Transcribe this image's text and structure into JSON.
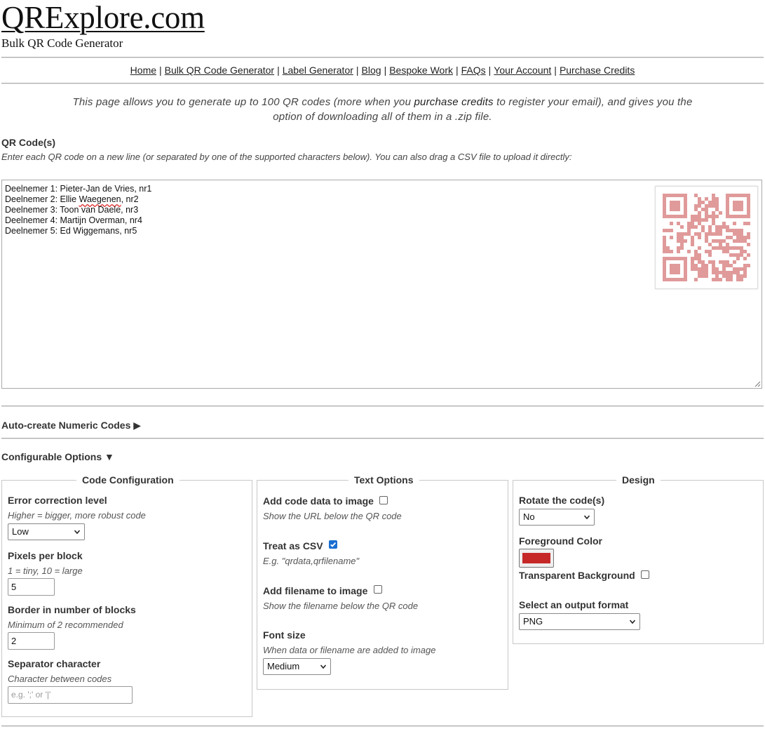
{
  "site": {
    "logo": "QRExplore.com",
    "tagline": "Bulk QR Code Generator"
  },
  "nav": [
    {
      "label": "Home"
    },
    {
      "label": "Bulk QR Code Generator"
    },
    {
      "label": "Label Generator"
    },
    {
      "label": "Blog"
    },
    {
      "label": "Bespoke Work"
    },
    {
      "label": "FAQs"
    },
    {
      "label": "Your Account"
    },
    {
      "label": "Purchase Credits"
    }
  ],
  "nav_separator": "|",
  "intro": {
    "part1": "This page allows you to generate up to 100 QR codes (more when you ",
    "link": "purchase credits",
    "part2": " to register your email), and gives you the option of downloading all of them in a .zip file."
  },
  "qr_input": {
    "title": "QR Code(s)",
    "help": "Enter each QR code on a new line (or separated by one of the supported characters below). You can also drag a CSV file to upload it directly:",
    "lines": [
      "Deelnemer 1: Pieter-Jan de Vries, nr1",
      "Deelnemer 2: Ellie Waegenen, nr2",
      "Deelnemer 3: Toon van Daele, nr3",
      "Deelnemer 4: Martijn Overman, nr4",
      "Deelnemer 5: Ed Wiggemans, nr5"
    ]
  },
  "sections": {
    "auto_numeric": {
      "label": "Auto-create Numeric Codes",
      "arrow": "▶"
    },
    "configurable": {
      "label": "Configurable Options",
      "arrow": "▼"
    }
  },
  "code_config": {
    "legend": "Code Configuration",
    "error_label": "Error correction level",
    "error_hint": "Higher = bigger, more robust code",
    "error_value": "Low",
    "pixels_label": "Pixels per block",
    "pixels_hint": "1 = tiny, 10 = large",
    "pixels_value": "5",
    "border_label": "Border in number of blocks",
    "border_hint": "Minimum of 2 recommended",
    "border_value": "2",
    "separator_label": "Separator character",
    "separator_hint": "Character between codes",
    "separator_placeholder": "e.g. ';' or '|'"
  },
  "text_options": {
    "legend": "Text Options",
    "add_data_label": "Add code data to image",
    "add_data_checked": false,
    "add_data_hint": "Show the URL below the QR code",
    "csv_label": "Treat as CSV",
    "csv_checked": true,
    "csv_hint": "E.g. \"qrdata,qrfilename\"",
    "filename_label": "Add filename to image",
    "filename_checked": false,
    "filename_hint": "Show the filename below the QR code",
    "font_label": "Font size",
    "font_hint": "When data or filename are added to image",
    "font_value": "Medium"
  },
  "design": {
    "legend": "Design",
    "rotate_label": "Rotate the code(s)",
    "rotate_value": "No",
    "fg_label": "Foreground Color",
    "fg_color": "#c62828",
    "transparent_label": "Transparent Background",
    "transparent_checked": false,
    "format_label": "Select an output format",
    "format_value": "PNG"
  },
  "colors": {
    "qr_preview": "#e09a9a"
  }
}
